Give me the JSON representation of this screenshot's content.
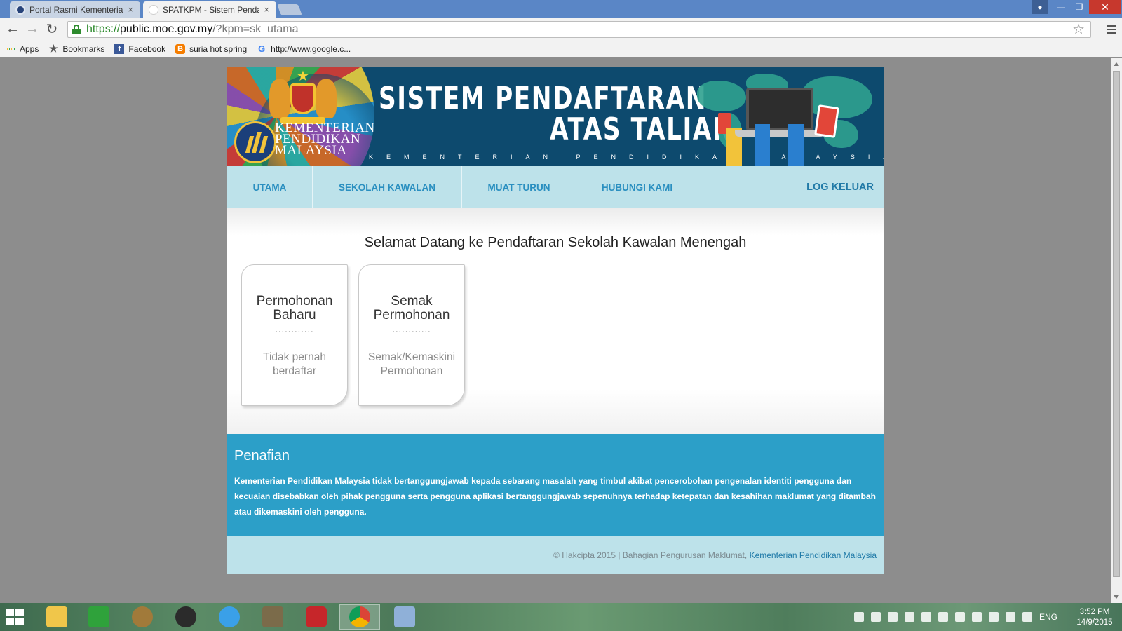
{
  "browser": {
    "tabs": [
      {
        "title": "Portal Rasmi Kementerian",
        "close": "×"
      },
      {
        "title": "SPATKPM - Sistem Pendaft",
        "close": "×"
      }
    ],
    "url": {
      "scheme": "https://",
      "host": "public.moe.gov.my",
      "path": "/?kpm=sk_utama"
    },
    "bookmarks": [
      "Apps",
      "Bookmarks",
      "Facebook",
      "suria hot spring",
      "http://www.google.c..."
    ]
  },
  "banner": {
    "ministry_line1": "KEMENTERIAN",
    "ministry_line2": "PENDIDIKAN",
    "ministry_line3": "MALAYSIA",
    "title_line1": "SISTEM PENDAFTARAN",
    "title_line2": "ATAS TALIAN",
    "subtitle": "KEMENTERIAN PENDIDIKAN MALAYSIA"
  },
  "nav": {
    "items": [
      "UTAMA",
      "SEKOLAH KAWALAN",
      "MUAT TURUN",
      "HUBUNGI KAMI"
    ],
    "logout": "LOG KELUAR"
  },
  "main": {
    "welcome": "Selamat Datang ke Pendaftaran Sekolah Kawalan Menengah",
    "cards": [
      {
        "title_line1": "Permohonan",
        "title_line2": "Baharu",
        "dots": "............",
        "desc_line1": "Tidak pernah",
        "desc_line2": "berdaftar"
      },
      {
        "title_line1": "Semak",
        "title_line2": "Permohonan",
        "dots": "............",
        "desc_line1": "Semak/Kemaskini",
        "desc_line2": "Permohonan"
      }
    ]
  },
  "disclaimer": {
    "title": "Penafian",
    "text": "Kementerian Pendidikan Malaysia tidak bertanggungjawab kepada sebarang masalah yang timbul akibat pencerobohan pengenalan identiti pengguna dan kecuaian disebabkan oleh pihak pengguna serta pengguna aplikasi bertanggungjawab sepenuhnya terhadap ketepatan dan kesahihan maklumat yang ditambah atau dikemaskini oleh pengguna."
  },
  "footer": {
    "copyright": "© Hakcipta 2015   |   Bahagian Pengurusan Maklumat, ",
    "link": "Kementerian Pendidikan Malaysia"
  },
  "taskbar": {
    "apps": [
      "file-explorer-icon",
      "store-icon",
      "media-icon",
      "speaker-app-icon",
      "internet-explorer-icon",
      "document-icon",
      "power-app-icon",
      "chrome-icon",
      "paint-icon"
    ],
    "language": "ENG",
    "time": "3:52 PM",
    "date": "14/9/2015"
  },
  "colors": {
    "nav_bg": "#bde2ea",
    "nav_text": "#2a8fc0",
    "disclaimer_bg": "#2c9fc8",
    "banner_bg": "#0d4a6e"
  }
}
